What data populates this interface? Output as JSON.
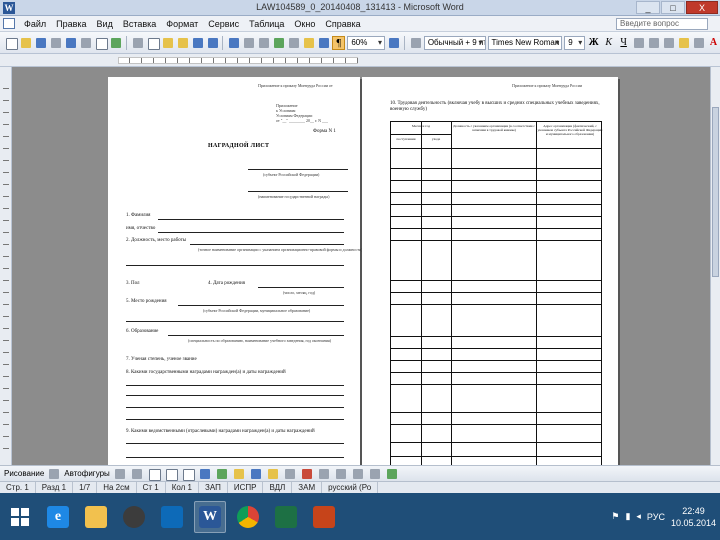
{
  "window": {
    "title": "LAW104589_0_20140408_131413 - Microsoft Word",
    "controls": [
      "_",
      "□",
      "X"
    ]
  },
  "menu": {
    "items": [
      "Файл",
      "Правка",
      "Вид",
      "Вставка",
      "Формат",
      "Сервис",
      "Таблица",
      "Окно",
      "Справка"
    ],
    "help_placeholder": "Введите вопрос"
  },
  "toolbar": {
    "zoom": "60%",
    "style": "Обычный + 9 пт, Г",
    "font": "Times New Roman",
    "size": "9",
    "bold": "Ж",
    "italic": "К",
    "underline": "Ч",
    "pilcrow": "¶",
    "font_color_label": "A"
  },
  "page1": {
    "header_small": "Приложение к приказу Минтруда России от",
    "attach_lines": [
      "Приложение",
      "к Условиям",
      "Условиям Федерации",
      "от \"__\" ________ 20__ г. N ___"
    ],
    "form_no": "Форма N 1",
    "heading": "НАГРАДНОЙ ЛИСТ",
    "sub1": "(субъект Российской Федерации)",
    "sub2": "(наименование государственной награды)",
    "fields": [
      "1. Фамилия",
      "имя, отчество",
      "2. Должность, место работы",
      "3. Пол",
      "4. Дата рождения",
      "5. Место рождения",
      "6. Образование",
      "7. Ученая степень, ученое звание",
      "8. Какими государственными наградами награжден(а) и даты награждений",
      "9. Какими ведомственными (отраслевыми) наградами награжден(а) и даты награждений"
    ],
    "hint_work": "(точное наименование организации с указанием организационно-правовой формы и должности)",
    "hint_date": "(число, месяц, год)",
    "hint_birth": "(субъект Российской Федерации, муниципальное образование)",
    "hint_edu": "(специальность по образованию, наименование учебного заведения, год окончания)"
  },
  "page2": {
    "header_small": "Приложение к приказу Минтруда России",
    "section": "10. Трудовая деятельность (включая учебу в высших и средних специальных учебных заведениях, военную службу)",
    "col_headers": [
      "Месяц и год",
      "Должность с указанием организации (в соответствии с записями в трудовой книжке)",
      "Адрес организации (фактический, с указанием субъекта Российской Федерации и муниципального образования)"
    ],
    "sub_headers": [
      "поступления",
      "ухода"
    ]
  },
  "drawbar": {
    "draw_label": "Рисование",
    "autoshapes_label": "Автофигуры"
  },
  "status": {
    "page": "Стр. 1",
    "section": "Разд 1",
    "pages": "1/7",
    "position": "На 2см",
    "line": "Ст 1",
    "col": "Кол 1",
    "zap": "ЗАП",
    "ispr": "ИСПР",
    "vdl": "ВДЛ",
    "zam": "ЗАМ",
    "lang": "русский (Ро"
  },
  "tray": {
    "lang": "РУС",
    "time": "22:49",
    "date": "10.05.2014"
  }
}
